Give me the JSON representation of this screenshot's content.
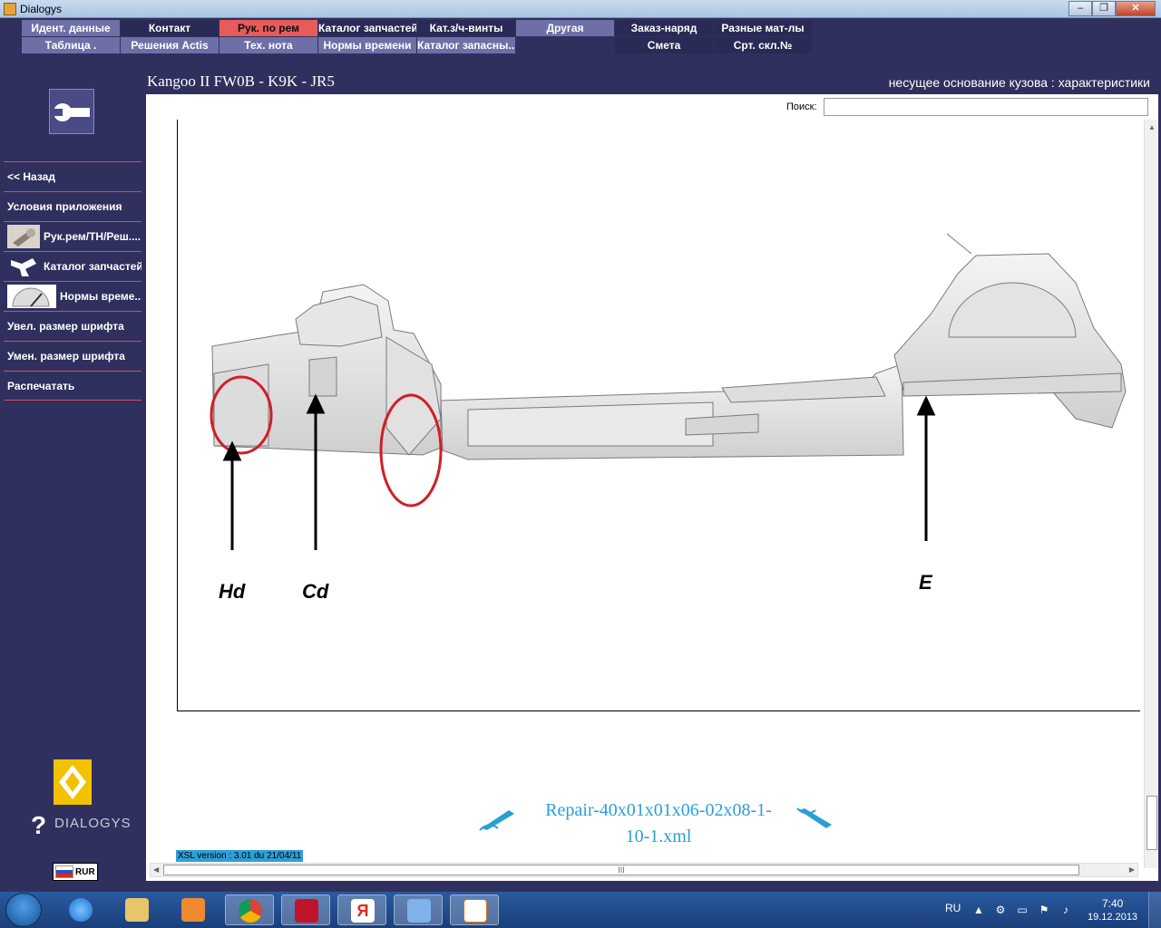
{
  "window": {
    "title": "Dialogys",
    "buttons": [
      "‒",
      "❐",
      "✕"
    ]
  },
  "menu": {
    "row1": [
      {
        "label": "Идент. данные",
        "style": "light"
      },
      {
        "label": "Контакт",
        "style": "dark"
      },
      {
        "label": "Рук. по рем",
        "style": "active"
      },
      {
        "label": "Каталог запчастей",
        "style": "dark"
      },
      {
        "label": "Кат.з/ч-винты",
        "style": "dark"
      },
      {
        "label": "Другая",
        "style": "light"
      },
      {
        "label": "Заказ-наряд",
        "style": "dark"
      },
      {
        "label": "Разные мат-лы",
        "style": "dark"
      }
    ],
    "row2": [
      {
        "label": "Таблица .",
        "style": "light"
      },
      {
        "label": "Решения Actis",
        "style": "light"
      },
      {
        "label": "Тех. нота",
        "style": "light"
      },
      {
        "label": "Нормы времени",
        "style": "light"
      },
      {
        "label": "Каталог запасны...",
        "style": "light"
      },
      {
        "label": "",
        "style": "empty"
      },
      {
        "label": "Смета",
        "style": "dark"
      },
      {
        "label": "Срт. скл.№",
        "style": "dark"
      }
    ]
  },
  "header": {
    "vehicle": "Kangoo II FW0B - K9K - JR5",
    "subtitle": "несущее основание кузова : характеристики"
  },
  "sidebar": {
    "items": [
      {
        "label": "<< Назад",
        "thumb": ""
      },
      {
        "label": "Условия приложения",
        "thumb": ""
      },
      {
        "label": "Рук.рем/ТН/Реш....",
        "thumb": "wrench"
      },
      {
        "label": "Каталог запчастей",
        "thumb": "parts"
      },
      {
        "label": "Нормы време...",
        "thumb": "gauge"
      },
      {
        "label": "Увел. размер шрифта",
        "thumb": ""
      },
      {
        "label": "Умен. размер шрифта",
        "thumb": ""
      },
      {
        "label": "Распечатать",
        "thumb": ""
      }
    ],
    "brand": "DIALOGYS",
    "currency": "RUR"
  },
  "content": {
    "search_label": "Поиск:",
    "search_value": "",
    "labels": [
      "Hd",
      "Cd",
      "E"
    ],
    "file_name_line1": "Repair-40x01x01x06-02x08-1-",
    "file_name_line2": "10-1.xml",
    "xsl_version": "XSL version : 3.01 du 21/04/11",
    "hscroll_grip": "III"
  },
  "taskbar": {
    "apps": [
      "internet-explorer",
      "file-explorer",
      "media-player",
      "chrome",
      "kaspersky",
      "yandex",
      "volume-app",
      "java"
    ],
    "lang": "RU",
    "time": "7:40",
    "date": "19.12.2013"
  }
}
